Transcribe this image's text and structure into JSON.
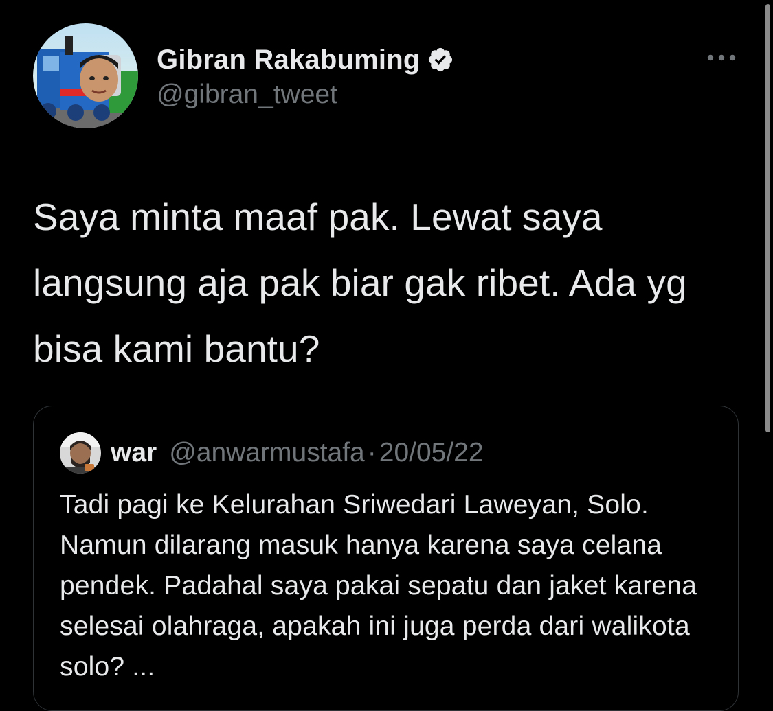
{
  "tweet": {
    "display_name": "Gibran Rakabuming",
    "handle": "@gibran_tweet",
    "verified_icon": "verified-badge-icon",
    "more_icon": "more-options-icon",
    "text": "Saya minta maaf pak. Lewat saya langsung aja pak biar gak ribet. Ada yg bisa kami bantu?"
  },
  "quote": {
    "display_name": "war",
    "handle": "@anwarmustafa",
    "separator": "·",
    "date": "20/05/22",
    "text": "Tadi pagi ke Kelurahan Sriwedari Laweyan, Solo. Namun dilarang masuk hanya karena saya celana pendek. Padahal saya pakai sepatu dan jaket karena selesai olahraga, apakah ini juga perda dari walikota solo? ..."
  },
  "colors": {
    "background": "#000000",
    "text_primary": "#e7e9ea",
    "text_secondary": "#71767b",
    "border": "#2f3336"
  }
}
